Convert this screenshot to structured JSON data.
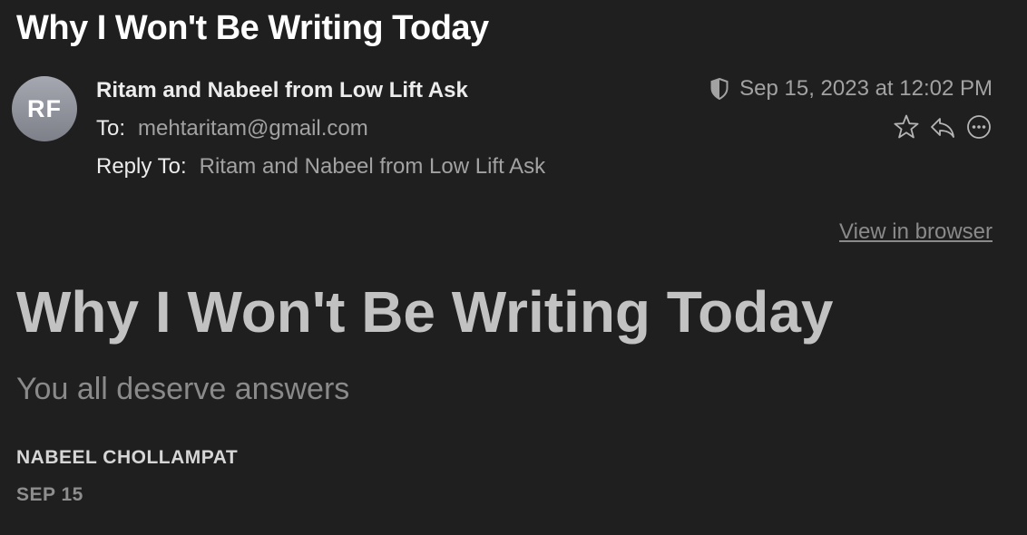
{
  "email": {
    "subject": "Why I Won't Be Writing Today",
    "avatar_initials": "RF",
    "sender": "Ritam and Nabeel from Low Lift Ask",
    "to_label": "To:",
    "to_value": "mehtaritam@gmail.com",
    "reply_to_label": "Reply To:",
    "reply_to_value": "Ritam and Nabeel from Low Lift Ask",
    "date": "Sep 15, 2023 at 12:02 PM",
    "icons": [
      "shield-icon",
      "star-icon",
      "reply-icon",
      "more-icon"
    ]
  },
  "body": {
    "view_in_browser": "View in browser",
    "headline": "Why I Won't Be Writing Today",
    "subtitle": "You all deserve answers",
    "author": "NABEEL CHOLLAMPAT",
    "pub_date": "SEP 15"
  },
  "colors": {
    "background": "#1f1f1f",
    "avatar": "#8f9099",
    "muted_text": "#a2a2a2"
  }
}
